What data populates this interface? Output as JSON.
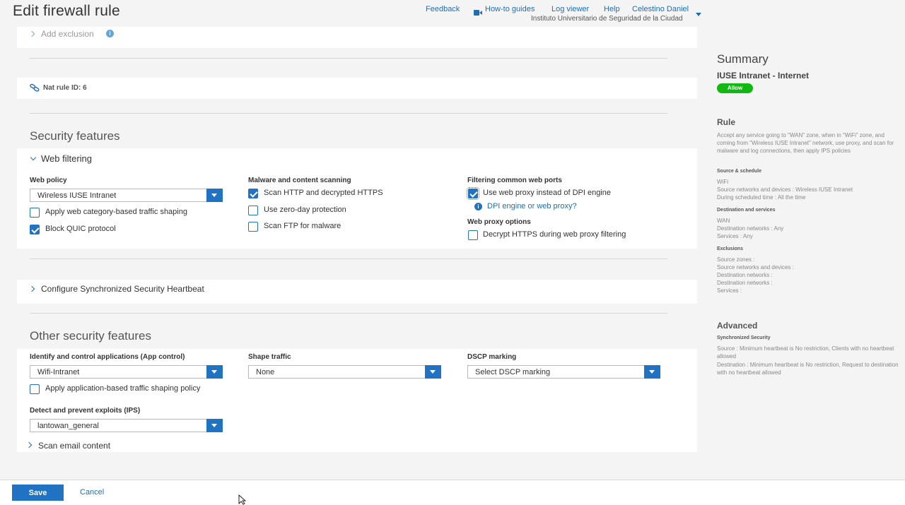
{
  "header": {
    "title": "Edit firewall rule",
    "links": {
      "feedback": "Feedback",
      "how_to": "How-to guides",
      "log_viewer": "Log viewer",
      "help": "Help",
      "user": "Celestino Daniel"
    },
    "organization": "Instituto Universitario de Seguridad de la Ciudad"
  },
  "add_exclusion": {
    "label": "Add exclusion"
  },
  "nat_rule": {
    "label": "Nat rule ID: 6"
  },
  "security_features": {
    "title": "Security features",
    "web_filtering": {
      "label": "Web filtering",
      "web_policy": {
        "label": "Web policy",
        "value": "Wireless IUSE Intranet"
      },
      "apply_shaping": {
        "label": "Apply web category-based traffic shaping",
        "checked": false
      },
      "block_quic": {
        "label": "Block QUIC protocol",
        "checked": true
      },
      "malware": {
        "label": "Malware and content scanning",
        "scan_http": {
          "label": "Scan HTTP and decrypted HTTPS",
          "checked": true
        },
        "zero_day": {
          "label": "Use zero-day protection",
          "checked": false
        },
        "scan_ftp": {
          "label": "Scan FTP for malware",
          "checked": false
        }
      },
      "ports": {
        "label": "Filtering common web ports",
        "use_proxy": {
          "label": "Use web proxy instead of DPI engine",
          "checked": true
        },
        "dpi_link": "DPI engine or web proxy?",
        "proxy_options": "Web proxy options",
        "decrypt_https": {
          "label": "Decrypt HTTPS during web proxy filtering",
          "checked": false
        }
      }
    },
    "heartbeat": {
      "label": "Configure Synchronized Security Heartbeat"
    }
  },
  "other_features": {
    "title": "Other security features",
    "app_control": {
      "label": "Identify and control applications (App control)",
      "value": "Wifi-Intranet"
    },
    "app_shaping": {
      "label": "Apply application-based traffic shaping policy",
      "checked": false
    },
    "shape_traffic": {
      "label": "Shape traffic",
      "value": "None"
    },
    "dscp": {
      "label": "DSCP marking",
      "value": "Select DSCP marking"
    },
    "ips": {
      "label": "Detect and prevent exploits (IPS)",
      "value": "lantowan_general"
    },
    "scan_email": {
      "label": "Scan email content"
    }
  },
  "summary": {
    "title": "Summary",
    "rule_name": "IUSE Intranet - Internet",
    "action": "Allow",
    "rule": {
      "title": "Rule",
      "description": "Accept any service going to \"WAN\" zone, when in \"WiFi\" zone, and coming from \"Wireless IUSE Intranet\" network, use proxy, and scan for malware and log connections, then apply IPS policies",
      "source_schedule": {
        "title": "Source & schedule",
        "lines": [
          "WiFi",
          "Source networks and devices : Wireless IUSE Intranet",
          "During scheduled time : All the time"
        ]
      },
      "destination_services": {
        "title": "Destination and services",
        "lines": [
          "WAN",
          "Destination networks : Any",
          "Services : Any"
        ]
      },
      "exclusions": {
        "title": "Exclusions",
        "lines": [
          "Source zones :",
          "Source networks and devices :",
          "Destination networks :",
          "Destination networks :",
          "Services :"
        ]
      }
    },
    "advanced": {
      "title": "Advanced",
      "sync_title": "Synchronized Security",
      "source": "Source : Minimum heartbeat is No restriction, Clients with no heartbeat allowed",
      "destination": "Destination : Minimum heartbeat is No restriction, Request to destination with no heartbeat allowed"
    }
  },
  "footer": {
    "save": "Save",
    "cancel": "Cancel"
  },
  "colors": {
    "accent": "#1f73c2",
    "allow": "#12b812"
  }
}
